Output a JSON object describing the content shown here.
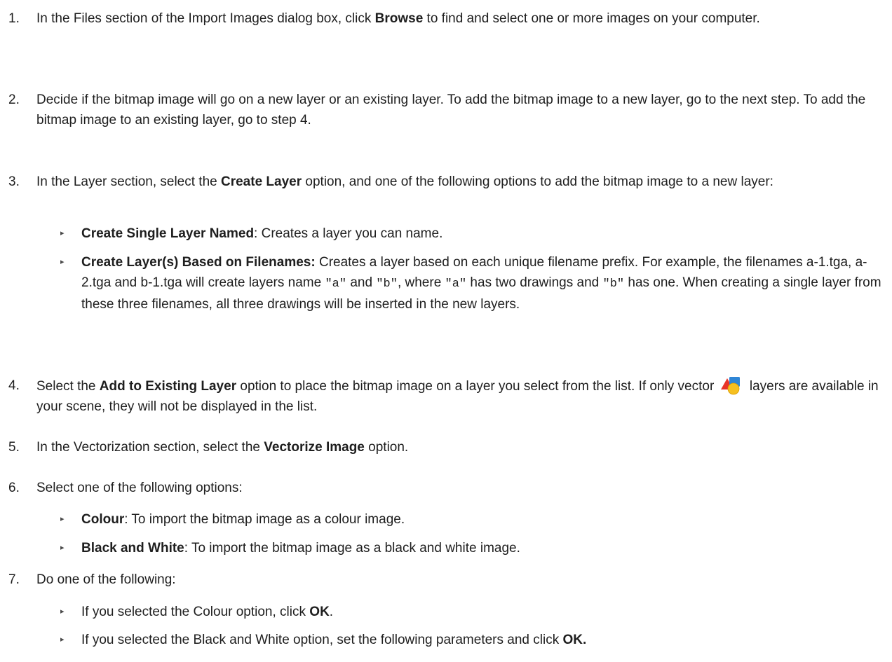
{
  "steps": [
    {
      "number": "1.",
      "parts": [
        {
          "t": "In the Files section of the Import Images dialog box, click "
        },
        {
          "b": "Browse"
        },
        {
          "t": " to find and select one or more images on your computer."
        }
      ]
    },
    {
      "number": "2.",
      "parts": [
        {
          "t": "Decide if the bitmap image will go on a new layer or an existing layer. To add the bitmap image to a new layer, go to the next step. To add the bitmap image to an existing layer, go to step 4."
        }
      ]
    },
    {
      "number": "3.",
      "parts": [
        {
          "t": "In the Layer section, select the "
        },
        {
          "b": "Create Layer"
        },
        {
          "t": " option, and one of the following options to add the bitmap image to a new layer:"
        }
      ],
      "bullets": [
        [
          {
            "b": "Create Single Layer Named"
          },
          {
            "t": ": Creates a layer you can name."
          }
        ],
        [
          {
            "b": "Create Layer(s) Based on Filenames:"
          },
          {
            "t": " Creates a layer based on each unique filename prefix. For example, the filenames a-1.tga, a-2.tga and b-1.tga will create layers name "
          },
          {
            "m": "\"a\""
          },
          {
            "t": " and "
          },
          {
            "m": "\"b\""
          },
          {
            "t": ", where "
          },
          {
            "m": "\"a\""
          },
          {
            "t": " has two drawings and "
          },
          {
            "m": "\"b\""
          },
          {
            "t": " has one. When creating a single layer from these three filenames, all three drawings will be inserted in the new layers."
          }
        ]
      ]
    },
    {
      "number": "4.",
      "parts": [
        {
          "t": "Select the "
        },
        {
          "b": "Add to Existing Layer"
        },
        {
          "t": " option to place the bitmap image on a layer you select from the list. If only vector "
        },
        {
          "icon": "vector-layer-icon"
        },
        {
          "t": " layers are available in your scene, they will not be displayed in the list."
        }
      ]
    },
    {
      "number": "5.",
      "parts": [
        {
          "t": "In the Vectorization section, select the "
        },
        {
          "b": "Vectorize Image"
        },
        {
          "t": " option."
        }
      ]
    },
    {
      "number": "6.",
      "parts": [
        {
          "t": "Select one of the following options:"
        }
      ],
      "bullets": [
        [
          {
            "b": "Colour"
          },
          {
            "t": ": To import the bitmap image as a colour image."
          }
        ],
        [
          {
            "b": "Black and White"
          },
          {
            "t": ": To import the bitmap image as a black and white image."
          }
        ]
      ]
    },
    {
      "number": "7.",
      "parts": [
        {
          "t": "Do one of the following:"
        }
      ],
      "bullets": [
        [
          {
            "t": "If you selected the Colour option, click "
          },
          {
            "b": "OK"
          },
          {
            "t": "."
          }
        ],
        [
          {
            "t": "If you selected the Black and White option, set the following parameters and click "
          },
          {
            "b": "OK."
          }
        ]
      ]
    }
  ],
  "bullet_glyph": "▸",
  "colors": {
    "text": "#1e1e1e",
    "icon_triangle": "#e8352a",
    "icon_square": "#2f86d6",
    "icon_circle": "#f6c020"
  }
}
